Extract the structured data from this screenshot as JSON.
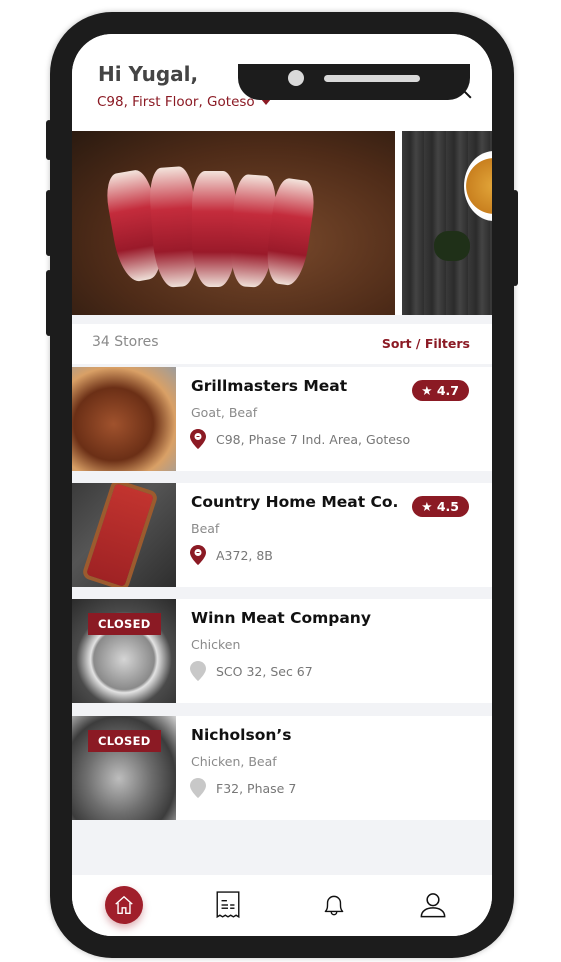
{
  "header": {
    "greeting": "Hi Yugal,",
    "address": "C98, First Floor, Goteso",
    "icons": [
      "star-icon",
      "search-icon"
    ]
  },
  "banners": [
    {
      "subject": "raw lamb chops on wooden board"
    },
    {
      "subject": "fried food on dark wood"
    }
  ],
  "list": {
    "count_label": "34 Stores",
    "sort_label": "Sort / Filters"
  },
  "stores": [
    {
      "name": "Grillmasters Meat",
      "categories": "Goat, Beaf",
      "location": "C98, Phase 7 Ind. Area, Goteso",
      "rating": "★ 4.7",
      "status": "open"
    },
    {
      "name": "Country Home Meat Co.",
      "categories": "Beaf",
      "location": "A372, 8B",
      "rating": "★ 4.5",
      "status": "open"
    },
    {
      "name": "Winn Meat Company",
      "categories": "Chicken",
      "location": "SCO 32, Sec 67",
      "badge": "CLOSED",
      "status": "closed"
    },
    {
      "name": "Nicholson’s",
      "categories": "Chicken, Beaf",
      "location": "F32, Phase 7",
      "badge": "CLOSED",
      "status": "closed"
    }
  ],
  "tabbar": {
    "items": [
      {
        "name": "home",
        "icon": "home-icon",
        "active": true
      },
      {
        "name": "orders",
        "icon": "receipt-icon",
        "active": false
      },
      {
        "name": "notifications",
        "icon": "bell-icon",
        "active": false
      },
      {
        "name": "profile",
        "icon": "user-icon",
        "active": false
      }
    ]
  },
  "colors": {
    "accent": "#8b1a24",
    "background": "#f2f3f6",
    "phone_frame": "#1c1c1c"
  }
}
